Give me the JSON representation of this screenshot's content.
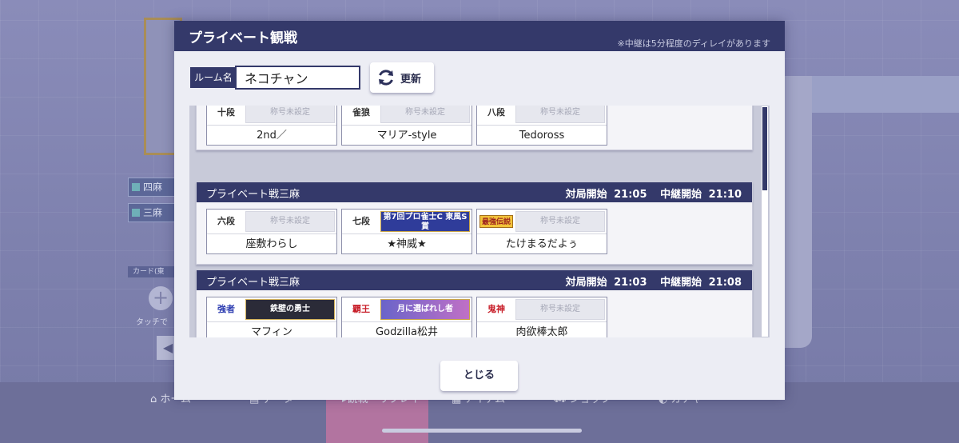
{
  "background": {
    "modes": [
      "四麻",
      "三麻"
    ],
    "card_label": "カード(東",
    "touch_hint": "タッチで",
    "nav": [
      {
        "label": "ホーム",
        "icon": "home-icon"
      },
      {
        "label": "データ",
        "icon": "data-icon"
      },
      {
        "label": "観戦・リプレイ",
        "icon": "spectate-icon"
      },
      {
        "label": "アイテム",
        "icon": "item-icon"
      },
      {
        "label": "ショップ",
        "icon": "shop-icon"
      },
      {
        "label": "ガチャ",
        "icon": "gacha-icon"
      }
    ]
  },
  "modal": {
    "title": "プライベート観戦",
    "note": "※中継は5分程度のディレイがあります",
    "room_label": "ルーム名",
    "room_value": "ネコチャン",
    "refresh_label": "更新",
    "close_label": "とじる",
    "scroll_position": 0.0
  },
  "matches": [
    {
      "name": "",
      "start_label": "",
      "start_time": "",
      "relay_label": "",
      "relay_time": "",
      "players": [
        {
          "rank": "十段",
          "title": "称号未設定",
          "name": "2nd／"
        },
        {
          "rank": "雀狼",
          "title": "称号未設定",
          "name": "マリア-style"
        },
        {
          "rank": "八段",
          "title": "称号未設定",
          "name": "Tedoross"
        }
      ]
    },
    {
      "name": "プライベート戦三麻",
      "start_label": "対局開始",
      "start_time": "21:05",
      "relay_label": "中継開始",
      "relay_time": "21:10",
      "players": [
        {
          "rank": "六段",
          "title": "称号未設定",
          "name": "座敷わらし"
        },
        {
          "rank": "七段",
          "title": "第7回プロ雀士C 東風S賞",
          "name": "★神威★"
        },
        {
          "rank": "最強伝説",
          "title": "称号未設定",
          "name": "たけまるだよぅ"
        }
      ]
    },
    {
      "name": "プライベート戦三麻",
      "start_label": "対局開始",
      "start_time": "21:03",
      "relay_label": "中継開始",
      "relay_time": "21:08",
      "players": [
        {
          "rank": "強者",
          "title": "鉄壁の勇士",
          "name": "マフィン"
        },
        {
          "rank": "覇王",
          "title": "月に選ばれし者",
          "name": "Godzilla松井"
        },
        {
          "rank": "鬼神",
          "title": "称号未設定",
          "name": "肉欲棒太郎"
        }
      ]
    }
  ]
}
